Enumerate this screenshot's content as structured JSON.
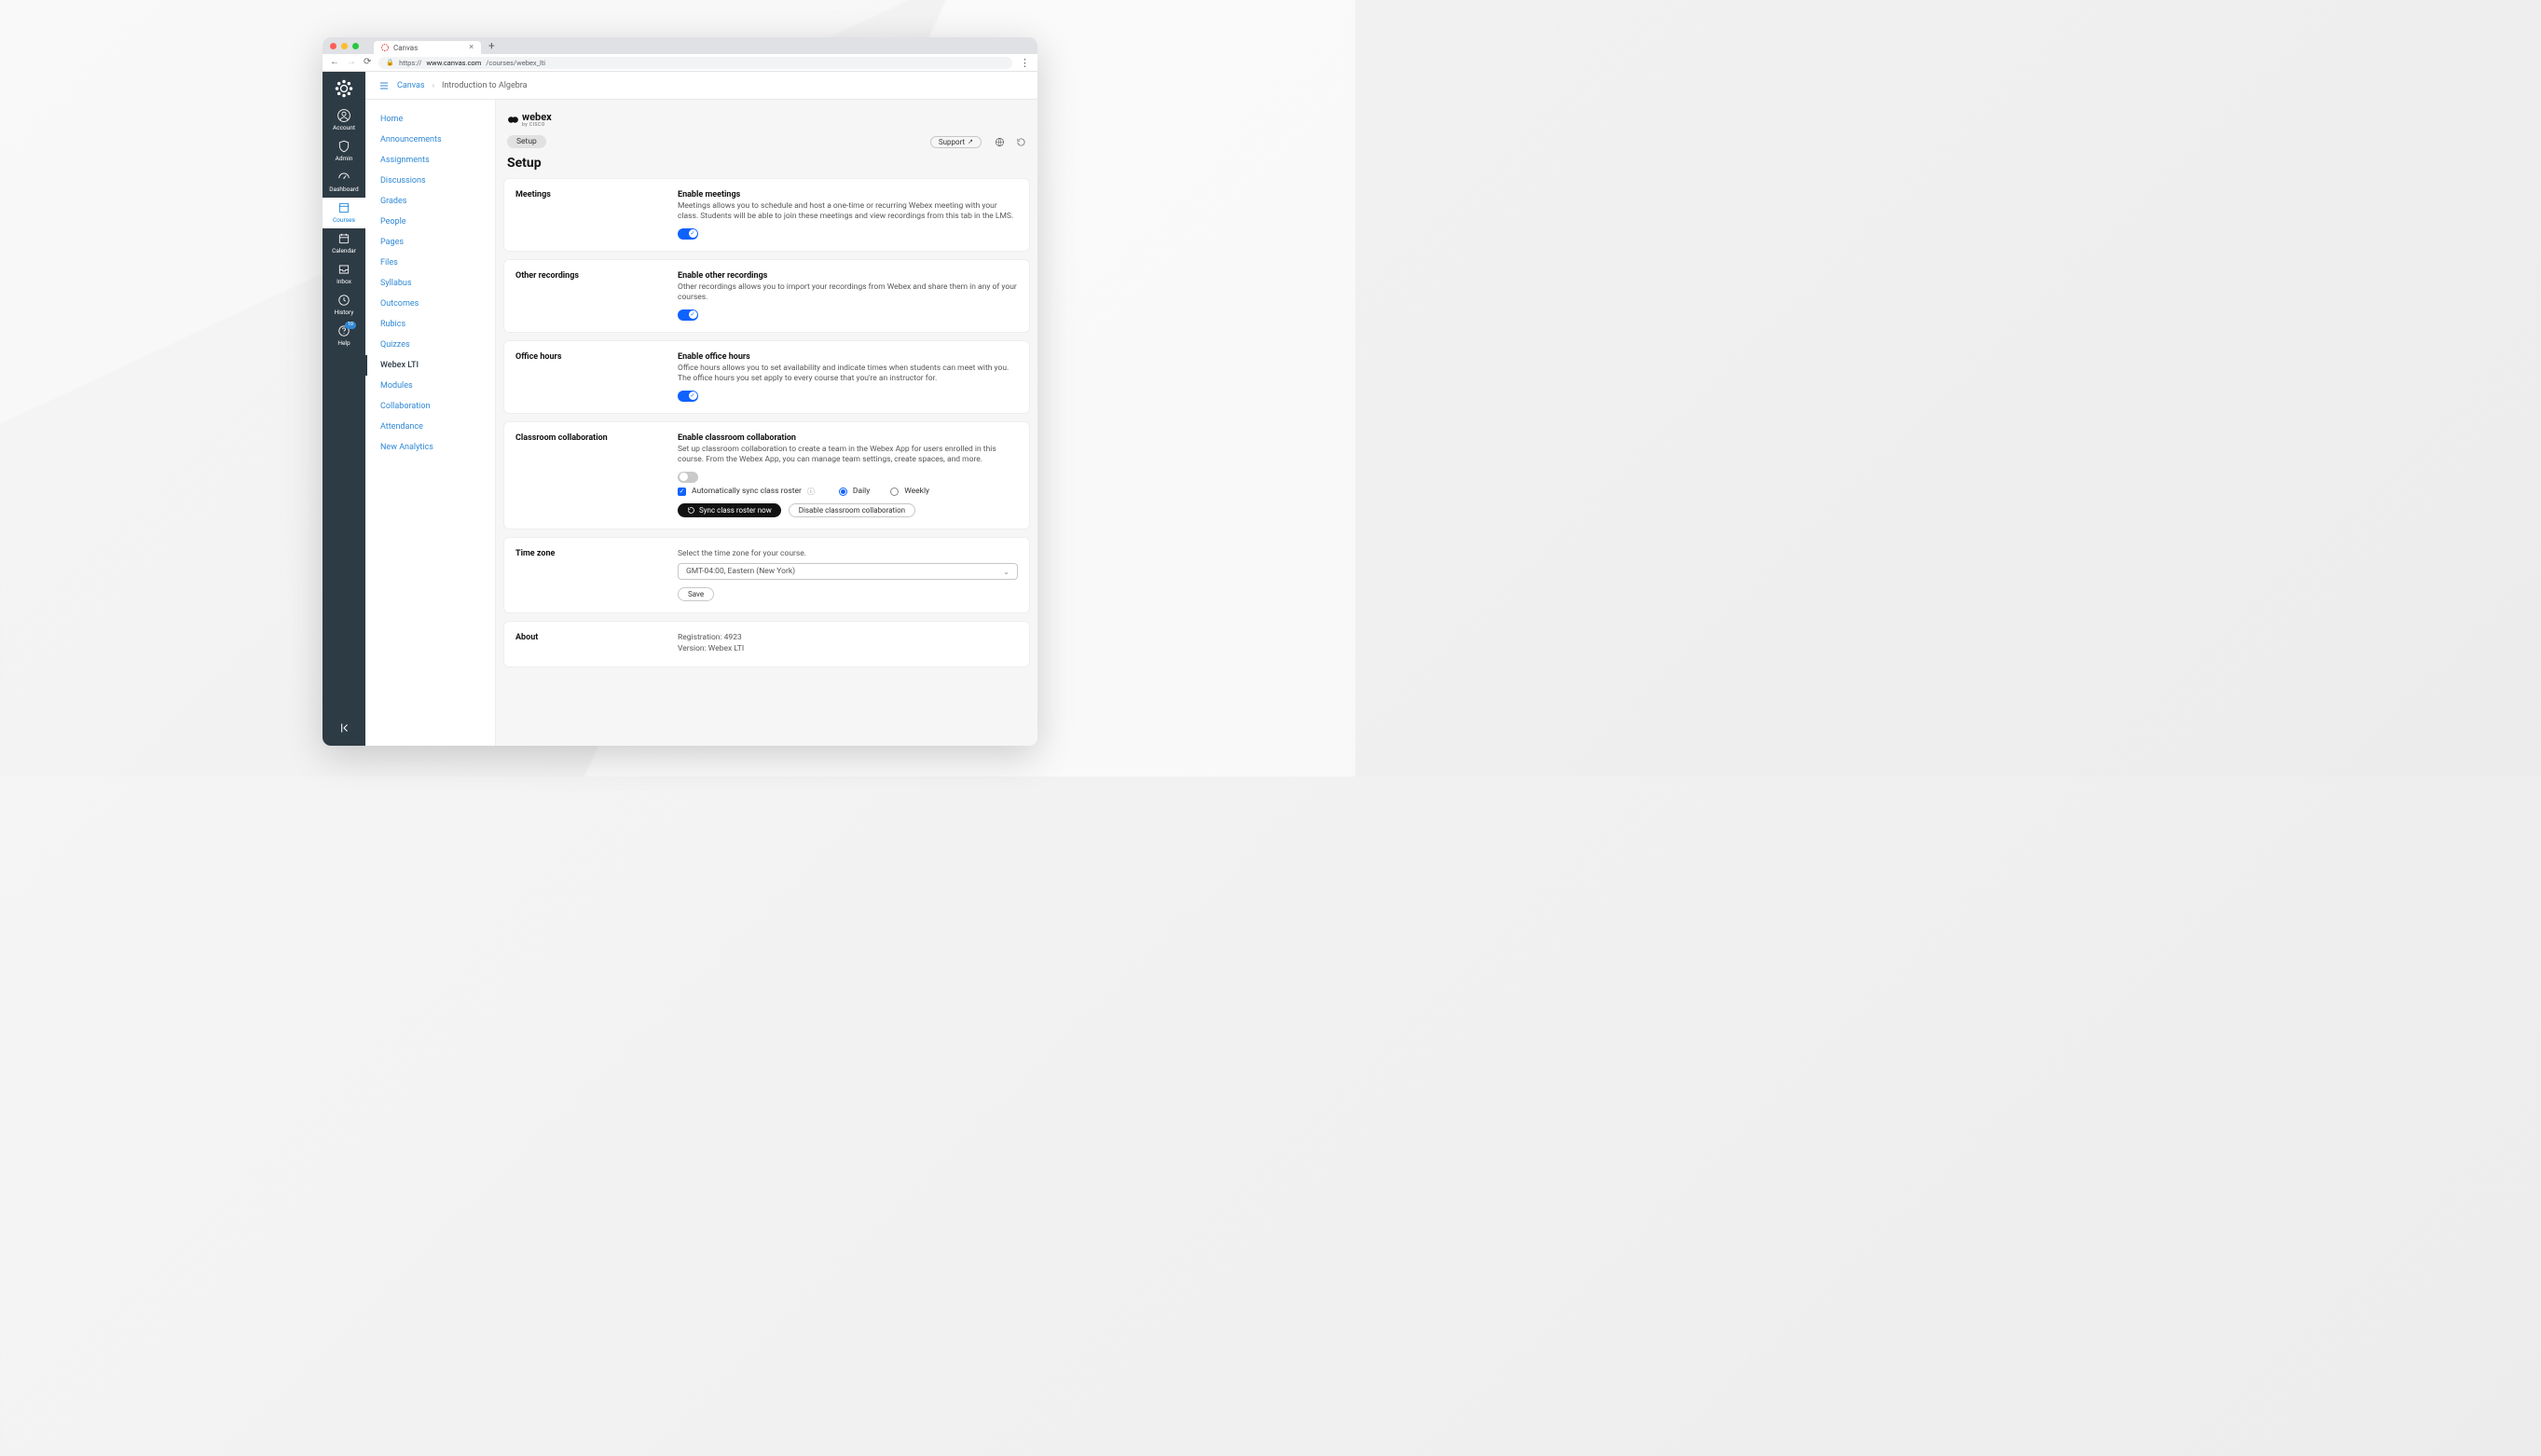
{
  "browser": {
    "tab_title": "Canvas",
    "url_prefix": "https://",
    "url_host": "www.canvas.com",
    "url_path": "/courses/webex_lti"
  },
  "global_nav": {
    "items": [
      {
        "label": "Account"
      },
      {
        "label": "Admin"
      },
      {
        "label": "Dashboard"
      },
      {
        "label": "Courses"
      },
      {
        "label": "Calendar"
      },
      {
        "label": "Inbox"
      },
      {
        "label": "History"
      },
      {
        "label": "Help",
        "badge": "10"
      }
    ]
  },
  "breadcrumb": {
    "root": "Canvas",
    "current": "Introduction to Algebra"
  },
  "course_nav": {
    "items": [
      "Home",
      "Announcements",
      "Assignments",
      "Discussions",
      "Grades",
      "People",
      "Pages",
      "Files",
      "Syllabus",
      "Outcomes",
      "Rubics",
      "Quizzes",
      "Webex LTI",
      "Modules",
      "Collaboration",
      "Attendance",
      "New Analytics"
    ],
    "active_index": 12
  },
  "webex": {
    "brand": "webex",
    "brand_sub": "by CISCO",
    "nav_pill": "Setup",
    "support_label": "Support",
    "page_title": "Setup"
  },
  "sections": {
    "meetings": {
      "title": "Meetings",
      "subhead": "Enable meetings",
      "desc": "Meetings allows you to schedule and host a one-time or recurring Webex meeting with your class. Students will be able to join these meetings and view recordings from this tab in the LMS.",
      "toggle_on": true
    },
    "recordings": {
      "title": "Other recordings",
      "subhead": "Enable other recordings",
      "desc": "Other recordings allows you to import your recordings from Webex and share them in any of your courses.",
      "toggle_on": true
    },
    "office": {
      "title": "Office hours",
      "subhead": "Enable office hours",
      "desc": "Office hours allows you to set availability and indicate times when students can meet with you. The office hours you set apply to every course that you're an instructor for.",
      "toggle_on": true
    },
    "collab": {
      "title": "Classroom collaboration",
      "subhead": "Enable classroom collaboration",
      "desc": "Set up classroom collaboration to create a team in the Webex App for users enrolled in this course. From the Webex App, you can manage team settings, create spaces, and more.",
      "toggle_on": false,
      "auto_sync_label": "Automatically sync class roster",
      "radio_daily": "Daily",
      "radio_weekly": "Weekly",
      "sync_now": "Sync class roster now",
      "disable_btn": "Disable classroom collaboration"
    },
    "timezone": {
      "title": "Time zone",
      "desc": "Select the time zone for your course.",
      "value": "GMT-04:00, Eastern (New York)",
      "save": "Save"
    },
    "about": {
      "title": "About",
      "registration_label": "Registration:",
      "registration_value": "4923",
      "version_label": "Version:",
      "version_value": "Webex LTI"
    }
  }
}
